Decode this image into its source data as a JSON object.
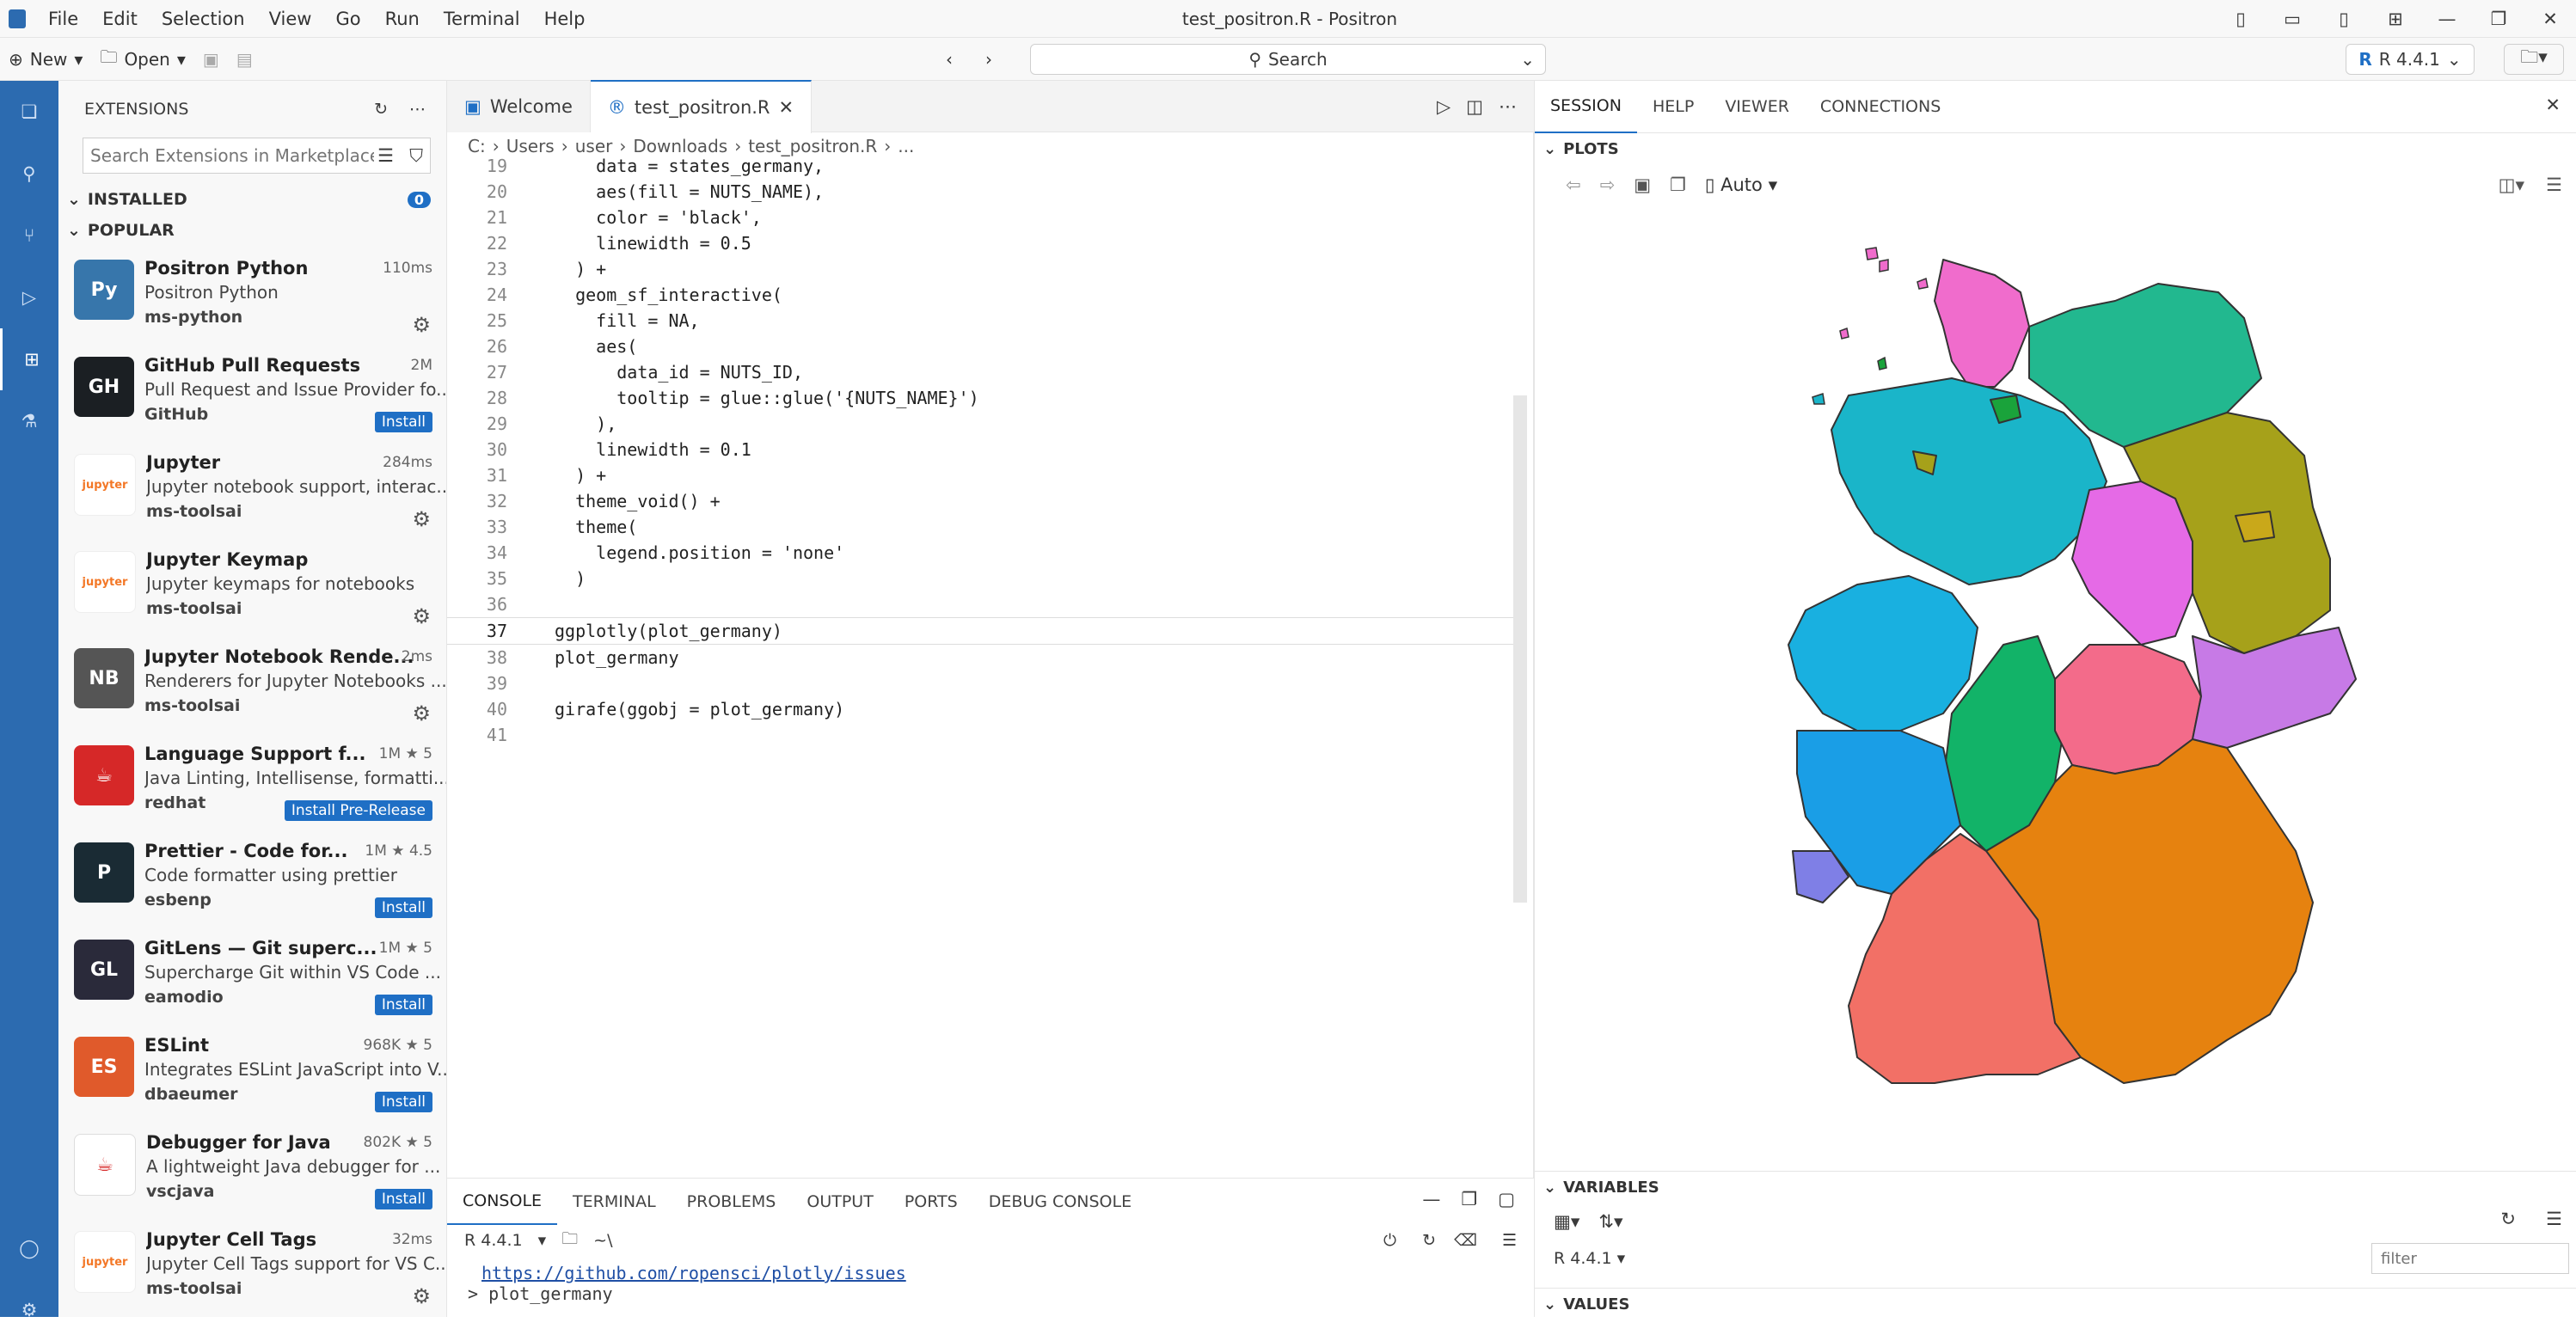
{
  "menu": [
    "File",
    "Edit",
    "Selection",
    "View",
    "Go",
    "Run",
    "Terminal",
    "Help"
  ],
  "window_title": "test_positron.R - Positron",
  "toolbar": {
    "new_label": "New",
    "open_label": "Open",
    "search_label": "Search",
    "r_version": "R 4.4.1"
  },
  "sidebar": {
    "title": "EXTENSIONS",
    "search_placeholder": "Search Extensions in Marketplace",
    "installed_label": "INSTALLED",
    "installed_count": "0",
    "popular_label": "POPULAR",
    "extensions": [
      {
        "name": "Positron Python",
        "desc": "Positron Python",
        "publisher": "ms-python",
        "meta": "110ms",
        "action": "",
        "icon": "Py",
        "color": "#3776ab"
      },
      {
        "name": "GitHub Pull Requests",
        "desc": "Pull Request and Issue Provider fo...",
        "publisher": "GitHub",
        "meta": "2M",
        "action": "Install",
        "icon": "GH",
        "color": "#1b1f23"
      },
      {
        "name": "Jupyter",
        "desc": "Jupyter notebook support, interac...",
        "publisher": "ms-toolsai",
        "meta": "284ms",
        "action": "",
        "icon": "jupyter",
        "color": "#f37726"
      },
      {
        "name": "Jupyter Keymap",
        "desc": "Jupyter keymaps for notebooks",
        "publisher": "ms-toolsai",
        "meta": "",
        "action": "",
        "icon": "jupyter",
        "color": "#f37726"
      },
      {
        "name": "Jupyter Notebook Rende...",
        "desc": "Renderers for Jupyter Notebooks ...",
        "publisher": "ms-toolsai",
        "meta": "2ms",
        "action": "",
        "icon": "NB",
        "color": "#555555"
      },
      {
        "name": "Language Support f...",
        "desc": "Java Linting, Intellisense, formatti...",
        "publisher": "redhat",
        "meta": "1M ★ 5",
        "action": "Install Pre-Release",
        "icon": "☕",
        "color": "#d62828"
      },
      {
        "name": "Prettier - Code for...",
        "desc": "Code formatter using prettier",
        "publisher": "esbenp",
        "meta": "1M ★ 4.5",
        "action": "Install",
        "icon": "P",
        "color": "#1a2b34"
      },
      {
        "name": "GitLens — Git superc...",
        "desc": "Supercharge Git within VS Code ...",
        "publisher": "eamodio",
        "meta": "1M ★ 5",
        "action": "Install",
        "icon": "GL",
        "color": "#2a2a3a"
      },
      {
        "name": "ESLint",
        "desc": "Integrates ESLint JavaScript into V...",
        "publisher": "dbaeumer",
        "meta": "968K ★ 5",
        "action": "Install",
        "icon": "ES",
        "color": "#e05a2b"
      },
      {
        "name": "Debugger for Java",
        "desc": "A lightweight Java debugger for ...",
        "publisher": "vscjava",
        "meta": "802K ★ 5",
        "action": "Install",
        "icon": "☕",
        "color": "#ffffff"
      },
      {
        "name": "Jupyter Cell Tags",
        "desc": "Jupyter Cell Tags support for VS C...",
        "publisher": "ms-toolsai",
        "meta": "32ms",
        "action": "",
        "icon": "jupyter",
        "color": "#f37726"
      }
    ]
  },
  "editor": {
    "tabs": [
      {
        "label": "Welcome"
      },
      {
        "label": "test_positron.R"
      }
    ],
    "breadcrumb": [
      "C:",
      "Users",
      "user",
      "Downloads",
      "test_positron.R",
      "..."
    ],
    "lines": [
      {
        "n": "19",
        "t": "    data = states_germany,"
      },
      {
        "n": "20",
        "t": "    aes(fill = NUTS_NAME),"
      },
      {
        "n": "21",
        "t": "    color = 'black',"
      },
      {
        "n": "22",
        "t": "    linewidth = 0.5"
      },
      {
        "n": "23",
        "t": "  ) +"
      },
      {
        "n": "24",
        "t": "  geom_sf_interactive("
      },
      {
        "n": "25",
        "t": "    fill = NA,"
      },
      {
        "n": "26",
        "t": "    aes("
      },
      {
        "n": "27",
        "t": "      data_id = NUTS_ID,"
      },
      {
        "n": "28",
        "t": "      tooltip = glue::glue('{NUTS_NAME}')"
      },
      {
        "n": "29",
        "t": "    ),"
      },
      {
        "n": "30",
        "t": "    linewidth = 0.1"
      },
      {
        "n": "31",
        "t": "  ) +"
      },
      {
        "n": "32",
        "t": "  theme_void() +"
      },
      {
        "n": "33",
        "t": "  theme("
      },
      {
        "n": "34",
        "t": "    legend.position = 'none'"
      },
      {
        "n": "35",
        "t": "  )"
      },
      {
        "n": "36",
        "t": ""
      },
      {
        "n": "37",
        "t": "ggplotly(plot_germany)"
      },
      {
        "n": "38",
        "t": "plot_germany"
      },
      {
        "n": "39",
        "t": ""
      },
      {
        "n": "40",
        "t": "girafe(ggobj = plot_germany)"
      },
      {
        "n": "41",
        "t": ""
      }
    ]
  },
  "panel": {
    "tabs": [
      "CONSOLE",
      "TERMINAL",
      "PROBLEMS",
      "OUTPUT",
      "PORTS",
      "DEBUG CONSOLE"
    ],
    "r_version": "R 4.4.1",
    "dir": "~\\",
    "link": "https://github.com/ropensci/plotly/issues",
    "prompt_line": "> plot_germany"
  },
  "right": {
    "tabs": [
      "SESSION",
      "HELP",
      "VIEWER",
      "CONNECTIONS"
    ],
    "plots_label": "PLOTS",
    "zoom": "Auto",
    "variables_label": "VARIABLES",
    "r_version": "R 4.4.1",
    "filter_placeholder": "filter",
    "values_label": "VALUES"
  }
}
